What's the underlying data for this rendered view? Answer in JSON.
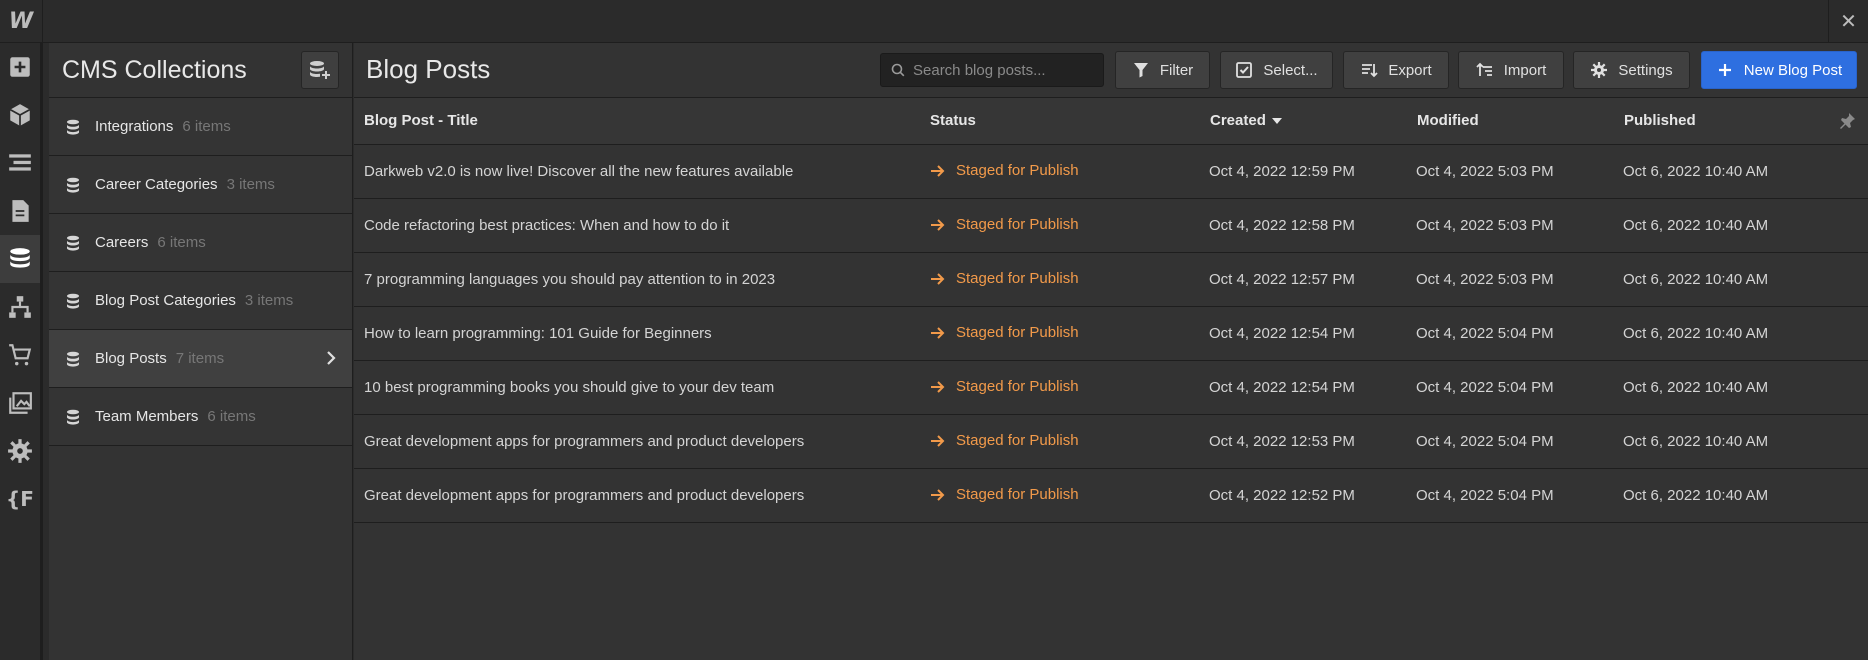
{
  "app": {
    "logo_letter": "W",
    "close_glyph": "✕"
  },
  "rail": [
    "add-icon",
    "cube-icon",
    "navigator-icon",
    "page-icon",
    "database-icon",
    "logic-icon",
    "cart-icon",
    "assets-icon",
    "gear-icon",
    "variables-icon"
  ],
  "rail_variables_text": "{F",
  "collections": {
    "title": "CMS Collections",
    "items": [
      {
        "name": "Integrations",
        "count": "6 items"
      },
      {
        "name": "Career Categories",
        "count": "3 items"
      },
      {
        "name": "Careers",
        "count": "6 items"
      },
      {
        "name": "Blog Post Categories",
        "count": "3 items"
      },
      {
        "name": "Blog Posts",
        "count": "7 items",
        "active": true
      },
      {
        "name": "Team Members",
        "count": "6 items"
      }
    ]
  },
  "main": {
    "title": "Blog Posts",
    "search_placeholder": "Search blog posts...",
    "buttons": {
      "filter": "Filter",
      "select": "Select...",
      "export": "Export",
      "import": "Import",
      "settings": "Settings",
      "new": "New Blog Post"
    },
    "columns": {
      "title": "Blog Post - Title",
      "status": "Status",
      "created": "Created",
      "modified": "Modified",
      "published": "Published"
    },
    "rows": [
      {
        "title": "Darkweb v2.0 is now live! Discover all the new features available",
        "status": "Staged for Publish",
        "created": "Oct 4, 2022 12:59 PM",
        "modified": "Oct 4, 2022 5:03 PM",
        "published": "Oct 6, 2022 10:40 AM"
      },
      {
        "title": "Code refactoring best practices: When and how to do it",
        "status": "Staged for Publish",
        "created": "Oct 4, 2022 12:58 PM",
        "modified": "Oct 4, 2022 5:03 PM",
        "published": "Oct 6, 2022 10:40 AM"
      },
      {
        "title": "7 programming languages you should pay attention to in 2023",
        "status": "Staged for Publish",
        "created": "Oct 4, 2022 12:57 PM",
        "modified": "Oct 4, 2022 5:03 PM",
        "published": "Oct 6, 2022 10:40 AM"
      },
      {
        "title": "How to learn programming: 101 Guide for Beginners",
        "status": "Staged for Publish",
        "created": "Oct 4, 2022 12:54 PM",
        "modified": "Oct 4, 2022 5:04 PM",
        "published": "Oct 6, 2022 10:40 AM"
      },
      {
        "title": "10 best programming books you should give to your dev team",
        "status": "Staged for Publish",
        "created": "Oct 4, 2022 12:54 PM",
        "modified": "Oct 4, 2022 5:04 PM",
        "published": "Oct 6, 2022 10:40 AM"
      },
      {
        "title": "Great development apps for programmers and product developers",
        "status": "Staged for Publish",
        "created": "Oct 4, 2022 12:53 PM",
        "modified": "Oct 4, 2022 5:04 PM",
        "published": "Oct 6, 2022 10:40 AM"
      },
      {
        "title": "Great development apps for programmers and product developers",
        "status": "Staged for Publish",
        "created": "Oct 4, 2022 12:52 PM",
        "modified": "Oct 4, 2022 5:04 PM",
        "published": "Oct 6, 2022 10:40 AM"
      }
    ]
  },
  "colors": {
    "accent": "#2e6fe0",
    "status": "#f29a4a",
    "bg": "#333333"
  }
}
